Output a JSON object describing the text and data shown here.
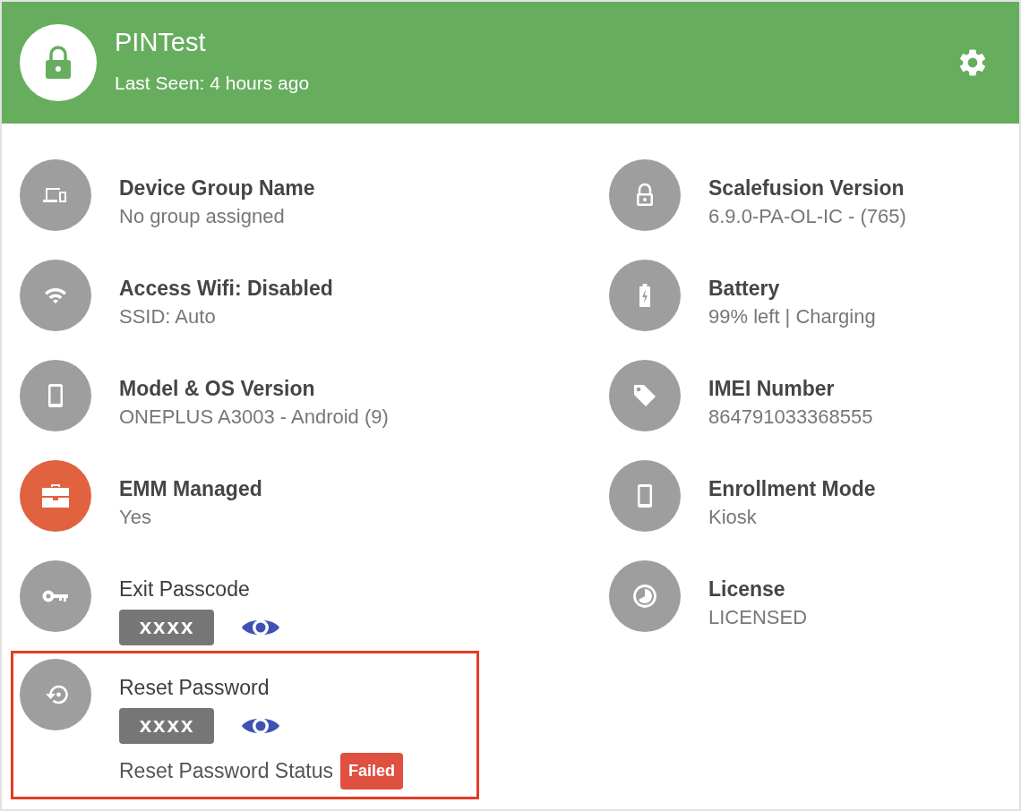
{
  "header": {
    "title": "PINTest",
    "subtitle": "Last Seen: 4 hours ago"
  },
  "left_items": [
    {
      "kind": "info",
      "title": "Device Group Name",
      "value": "No group assigned",
      "color": "#9e9e9e"
    },
    {
      "kind": "info",
      "title": "Access Wifi: Disabled",
      "value": "SSID: Auto",
      "color": "#9e9e9e"
    },
    {
      "kind": "info",
      "title": "Model & OS Version",
      "value": "ONEPLUS A3003 - Android (9)",
      "color": "#9e9e9e"
    },
    {
      "kind": "info",
      "title": "EMM Managed",
      "value": "Yes",
      "color": "#e0623f"
    },
    {
      "kind": "passcode",
      "title": "Exit Passcode",
      "masked_value": "xxxx",
      "color": "#9e9e9e"
    },
    {
      "kind": "reset",
      "title": "Reset Password",
      "masked_value": "xxxx",
      "status_label": "Reset Password Status",
      "status": "Failed",
      "color": "#9e9e9e",
      "highlighted": true
    }
  ],
  "right_items": [
    {
      "kind": "info",
      "title": "Scalefusion Version",
      "value": "6.9.0-PA-OL-IC - (765)",
      "color": "#9e9e9e"
    },
    {
      "kind": "info",
      "title": "Battery",
      "value": "99% left | Charging",
      "color": "#9e9e9e"
    },
    {
      "kind": "info",
      "title": "IMEI Number",
      "value": "864791033368555",
      "color": "#9e9e9e"
    },
    {
      "kind": "info",
      "title": "Enrollment Mode",
      "value": "Kiosk",
      "color": "#9e9e9e"
    },
    {
      "kind": "info",
      "title": "License",
      "value": "LICENSED",
      "color": "#9e9e9e"
    }
  ]
}
